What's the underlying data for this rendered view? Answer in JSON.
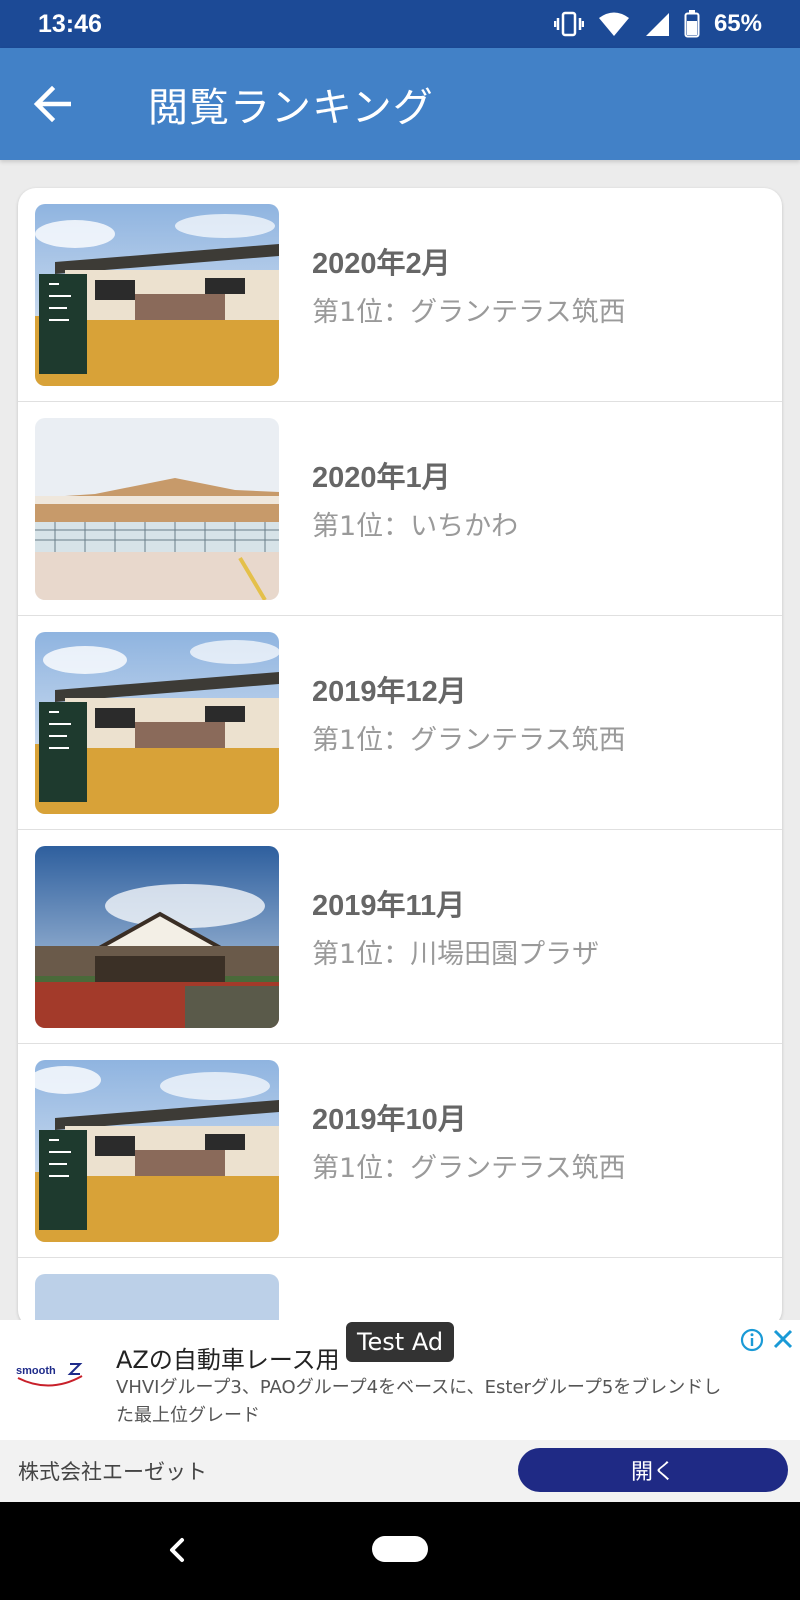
{
  "status_bar": {
    "time": "13:46",
    "battery": "65%"
  },
  "app_bar": {
    "title": "閲覧ランキング"
  },
  "rankings": [
    {
      "month": "2020年2月",
      "rank": "第1位：グランテラス筑西"
    },
    {
      "month": "2020年1月",
      "rank": "第1位：いちかわ"
    },
    {
      "month": "2019年12月",
      "rank": "第1位：グランテラス筑西"
    },
    {
      "month": "2019年11月",
      "rank": "第1位：川場田園プラザ"
    },
    {
      "month": "2019年10月",
      "rank": "第1位：グランテラス筑西"
    }
  ],
  "ad": {
    "badge": "Test Ad",
    "headline": "AZの自動車レース用",
    "body": "VHVIグループ3、PAOグループ4をベースに、Esterグループ5をブレンドした最上位グレード",
    "company": "株式会社エーゼット",
    "cta": "開く",
    "logo_text": "smooth"
  }
}
